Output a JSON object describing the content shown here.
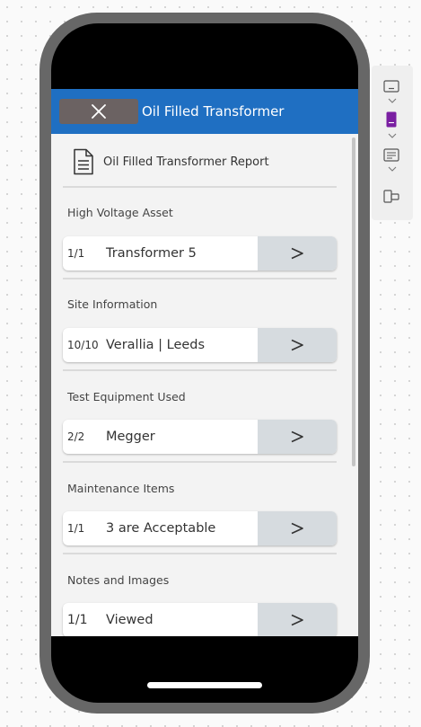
{
  "header": {
    "title": "Oil Filled Transformer"
  },
  "report": {
    "title": "Oil Filled Transformer Report"
  },
  "sections": [
    {
      "label": "High Voltage Asset",
      "count": "1/1",
      "value": "Transformer 5"
    },
    {
      "label": "Site Information",
      "count": "10/10",
      "value": "Verallia | Leeds"
    },
    {
      "label": "Test Equipment Used",
      "count": "2/2",
      "value": "Megger"
    },
    {
      "label": "Maintenance Items",
      "count": "1/1",
      "value": "3 are Acceptable"
    },
    {
      "label": "Notes and Images",
      "count": "1/1",
      "value": "Viewed"
    }
  ],
  "colors": {
    "header_bg": "#1f6fc2",
    "close_button_bg": "#6b6262",
    "arrow_button_bg": "#d6dbdf",
    "phone_frame": "#676767",
    "toolbar_accent": "#7a1fa2"
  },
  "icons": {
    "close": "close-icon",
    "report": "document-icon",
    "arrow": "chevron-right-icon",
    "toolbar": [
      "screen-icon",
      "color-swatch-icon",
      "form-icon",
      "component-icon"
    ]
  }
}
